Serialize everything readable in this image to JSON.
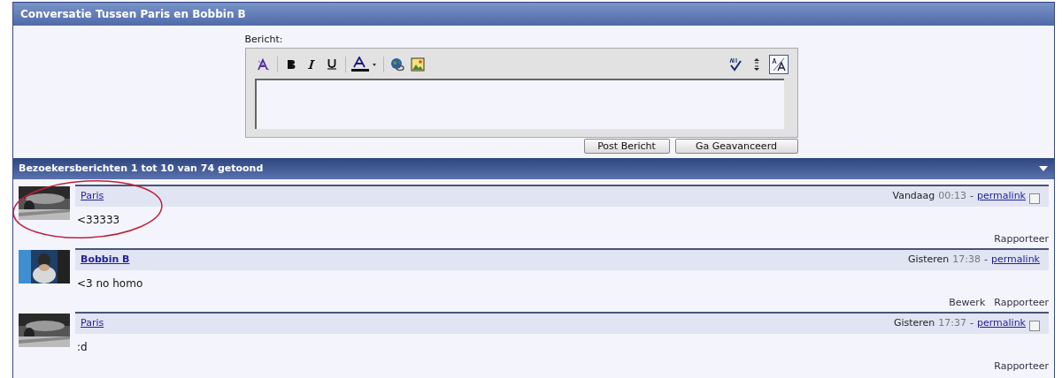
{
  "title": "Conversatie Tussen Paris en Bobbin B",
  "editor": {
    "label": "Bericht:",
    "buttons": [
      "Post Bericht",
      "Ga Geavanceerd"
    ]
  },
  "section": {
    "title": "Bezoekersberichten 1 tot 10 van 74 getoond"
  },
  "messages": [
    {
      "kind": "visitor",
      "author": "Paris",
      "day": "Vandaag",
      "time": "00:13",
      "separator": "-",
      "permalink": "permalink",
      "checkbox": {
        "checked": false
      },
      "text": "<33333",
      "actions": [
        "Rapporteer"
      ],
      "highlighted": true
    },
    {
      "kind": "own",
      "author": "Bobbin B",
      "day": "Gisteren",
      "time": "17:38",
      "separator": "-",
      "permalink": "permalink",
      "text": "<3 no homo",
      "actions": [
        "Bewerk",
        "Rapporteer"
      ],
      "highlighted": false
    },
    {
      "kind": "visitor",
      "author": "Paris",
      "day": "Gisteren",
      "time": "17:37",
      "separator": "-",
      "permalink": "permalink",
      "checkbox": {
        "checked": false
      },
      "text": ":d",
      "actions": [
        "Rapporteer"
      ],
      "highlighted": false
    }
  ]
}
